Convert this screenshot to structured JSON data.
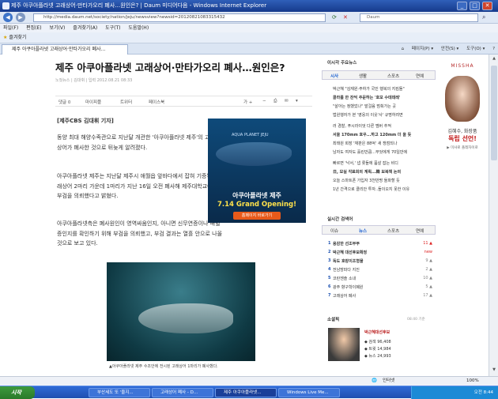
{
  "window": {
    "title": "제주 아쿠아플라넷 고래상어·만타가오리 폐사…원인은? | Daum 미디어다음 - Windows Internet Explorer",
    "btn_min": "_",
    "btn_max": "□",
    "btn_close": "✕"
  },
  "address": {
    "url": "http://media.daum.net/society/nation/jeju/newsview?newsid=20120821083315432",
    "search_placeholder": "Daum"
  },
  "menu": [
    "파일(F)",
    "편집(E)",
    "보기(V)",
    "즐겨찾기(A)",
    "도구(T)",
    "도움말(H)"
  ],
  "favorites": {
    "label": "즐겨찾기"
  },
  "tab": {
    "label": "제주 아쿠아플라넷 고래상어·만타가오리 폐사…"
  },
  "commands": [
    "페이지(P) ▾",
    "안전(S) ▾",
    "도구(O) ▾"
  ],
  "article": {
    "headline": "제주 아쿠아플라넷 고래상어·만타가오리 폐사…원인은?",
    "byline": "노컷뉴스 | 김대휘 | 입력 2012.08.21 08:33",
    "share": {
      "reply": "댓글 0",
      "mypeople": "마이피플",
      "twitter": "트위터",
      "facebook": "페이스북"
    },
    "reporter": "[제주CBS 김대휘 기자]",
    "para1": "동양 최대 해양수족관으로 지난달 개관한 '아쿠아플라넷 제주'의 고래상어가 폐사한 것으로 뒤늦게 알려졌다.",
    "para2": "아쿠아플라넷 제주는 지난달 제주시 애월읍 앞바다에서 잡혀 기증된 고래상어 2마리 가운데 1마리가 지난 16일 오전 폐사해 제주대학교에 부검을 의뢰했다고 밝혔다.",
    "para3": "아쿠아플라넷측은 폐사원인이 영역싸움인지, 아니면 신무연증이나 패혈증인지를 확인하기 위해 부검을 의뢰했고, 부검 결과는 열흘 안으로 나올 것으로 보고 있다.",
    "caption": "▲아쿠아플라넷 제주 수조안에 전시된 고래상어 1마리가 폐사했다."
  },
  "ad_aqua": {
    "top": "AQUA PLANET JEJU",
    "line1": "아쿠아플라넷 제주",
    "line2": "7.14 Grand Opening!",
    "button": "홈페이지 바로가기"
  },
  "right_panel": {
    "title": "이시각 주요뉴스",
    "tabs": [
      "시사",
      "생활",
      "스포츠",
      "연예"
    ],
    "news": [
      "박근혜 \"김재원·주하가 국민 행복의 지킴돌\"",
      "콜라를 한 잔씩 주문하는 '호모 수데데레'",
      "\"살아는 정했었나\" 발걸음 멈춰가는 곳",
      "법원행자가 본 '영웅의 이웃'사' 규명하려면",
      "러 경찰, 푸시라이엇 다른 멤버 추적",
      "서울 170mm 호우...하고 120mm 더 올 듯",
      "최태원 회장 '재판은 88억' 새 쟁점되나",
      "남자도 여자도 흘린만큼...무엇에게 70일만에",
      "빠르면 '낙서,' 냅 롯들에 품살 잡는 비디",
      "日, 모실 각료회의 계획...韓 보복책 논의",
      "오늘 스마트폰 가입자 3천만명 돌파할 듯",
      "1년 간격으로 클리안 투자..들이오지 못한 이유"
    ],
    "search_title": "실시간 검색어",
    "search_tabs": [
      "이슈",
      "뉴스",
      "스포츠",
      "연예"
    ],
    "keywords": [
      {
        "rank": "1",
        "text": "용감한 선조부부",
        "val": "11 ▲"
      },
      {
        "rank": "2",
        "text": "박근혜 대선후보확정",
        "val": "new"
      },
      {
        "rank": "3",
        "text": "독도 호랑이조형물",
        "val": "9 ▲"
      },
      {
        "rank": "4",
        "text": "전남방파다 지진",
        "val": "2 ▲"
      },
      {
        "rank": "5",
        "text": "코란젠솔 소내",
        "val": "10 ▲"
      },
      {
        "rank": "6",
        "text": "광주 향구학이폐원",
        "val": "5 ▲"
      },
      {
        "rank": "7",
        "text": "고래상어 폐사",
        "val": "17 ▲"
      }
    ],
    "fan_title": "소셜픽",
    "fan_time": "08:40 기준",
    "fan_name": "박근혜대선후보",
    "fan_stats": [
      "◆ 검색 96,408",
      "◆ 트윗 14,984",
      "◆ 뉴스 24,993"
    ]
  },
  "ad_missha": {
    "brand": "MISSHA",
    "name": "김혜수, 화장품",
    "big": "독립 선언!",
    "sub": "▶ 미샤로 폴레자이로"
  },
  "status": {
    "left": "",
    "zone": "인터넷",
    "zoom": "100%"
  },
  "taskbar": {
    "start": "시작",
    "tasks": [
      "부산세도 또 '울지...",
      "고래상어 폐사 - D...",
      "제주 아쿠아플라넷...",
      "Windows Live Me..."
    ],
    "clock": "오전 8:44"
  }
}
